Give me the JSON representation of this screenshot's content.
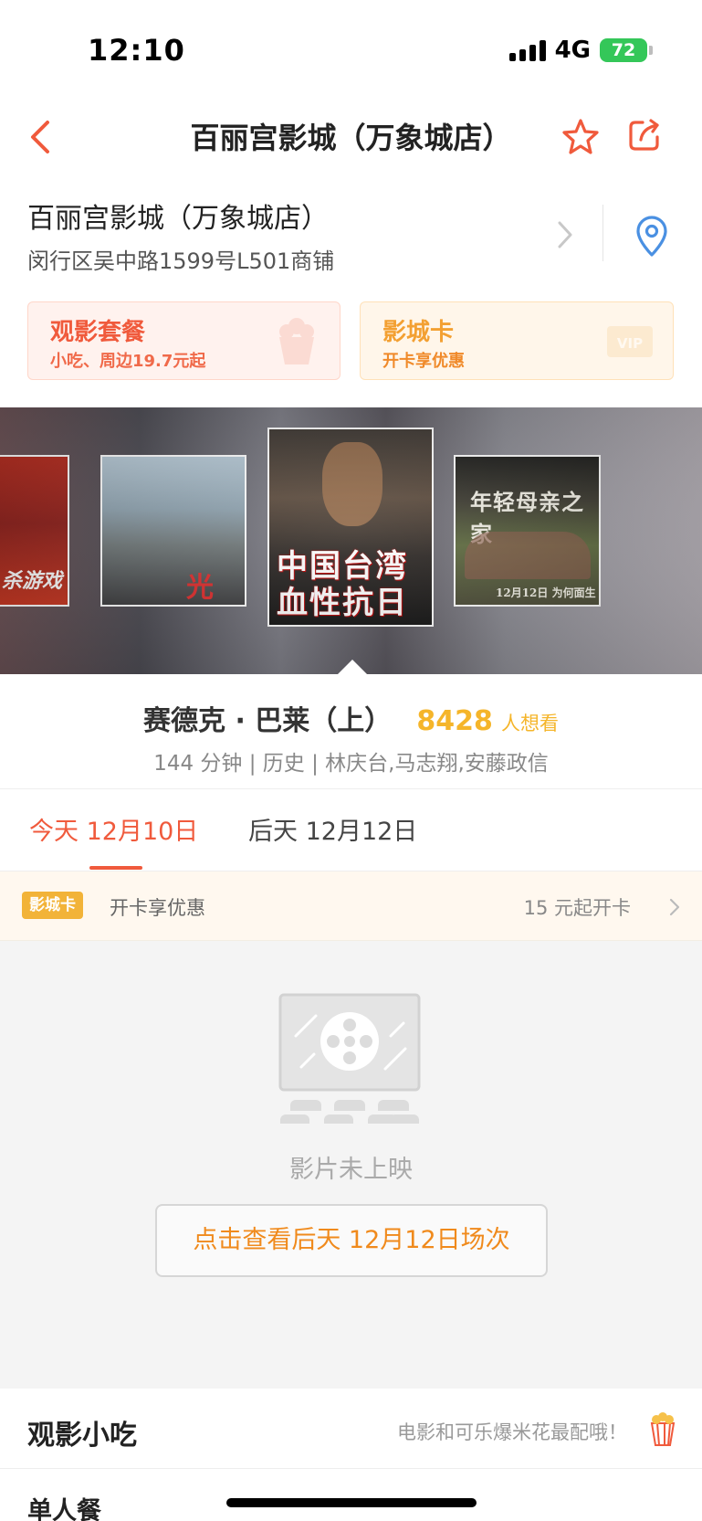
{
  "status": {
    "time": "12:10",
    "network": "4G",
    "battery": "72"
  },
  "nav": {
    "title": "百丽宫影城（万象城店）"
  },
  "cinema": {
    "name": "百丽宫影城（万象城店）",
    "address": "闵行区吴中路1599号L501商铺"
  },
  "promos": {
    "combo": {
      "title": "观影套餐",
      "subtitle": "小吃、周边19.7元起"
    },
    "card": {
      "title": "影城卡",
      "subtitle": "开卡享优惠"
    }
  },
  "posters": [
    {
      "text": "杀游戏"
    },
    {
      "text": "光"
    },
    {
      "line1": "中国台湾",
      "line2": "血性抗日"
    },
    {
      "text": "年轻母亲之家",
      "date": "12月12日 为何面生"
    }
  ],
  "movie": {
    "title": "赛德克 · 巴莱（上）",
    "want_count": "8428",
    "want_label": "人想看",
    "meta": "144 分钟 | 历史 | 林庆台,马志翔,安藤政信"
  },
  "dates": [
    {
      "label": "今天 12月10日",
      "active": true
    },
    {
      "label": "后天 12月12日",
      "active": false
    }
  ],
  "card_strip": {
    "badge": "影城卡",
    "text": "开卡享优惠",
    "price": "15 元起开卡"
  },
  "empty": {
    "message": "影片未上映",
    "button": "点击查看后天 12月12日场次"
  },
  "snacks": {
    "title": "观影小吃",
    "slogan": "电影和可乐爆米花最配哦！",
    "first_category": "单人餐"
  },
  "colors": {
    "accent": "#f05a3c",
    "gold": "#f5b52a",
    "orange": "#f08a1c"
  },
  "icons": [
    "back-arrow-icon",
    "star-icon",
    "share-icon",
    "chevron-right-icon",
    "location-pin-icon",
    "popcorn-icon",
    "vip-card-icon",
    "film-reel-icon"
  ]
}
